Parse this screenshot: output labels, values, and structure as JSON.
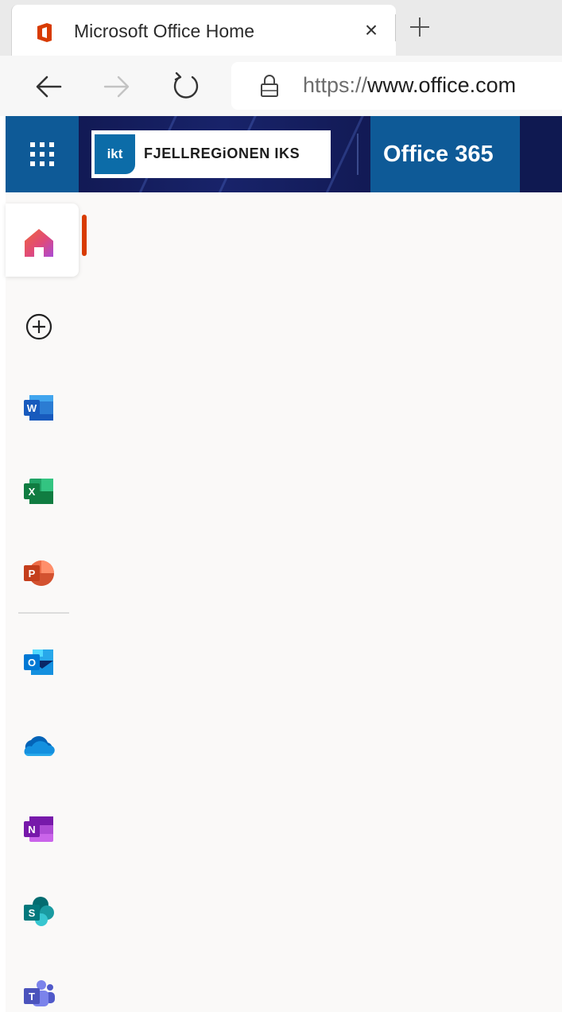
{
  "browser": {
    "tab": {
      "title": "Microsoft Office Home",
      "close_label": "×"
    },
    "address_bar": {
      "url_scheme": "https://",
      "url_host": "www.office.com"
    }
  },
  "header": {
    "org_logo_badge": "ikt",
    "org_logo_text": "FJELLREGiONEN IKS",
    "app_title": "Office 365",
    "colors": {
      "header_bg": "#0f1951",
      "accent_blue": "#0e5a97"
    }
  },
  "rail": {
    "items": [
      {
        "name": "Home",
        "icon": "home-icon",
        "active": true
      },
      {
        "name": "Create",
        "icon": "plus-circle-icon"
      },
      {
        "name": "Word",
        "icon": "word-icon"
      },
      {
        "name": "Excel",
        "icon": "excel-icon"
      },
      {
        "name": "PowerPoint",
        "icon": "powerpoint-icon"
      },
      {
        "name": "Outlook",
        "icon": "outlook-icon"
      },
      {
        "name": "OneDrive",
        "icon": "onedrive-icon"
      },
      {
        "name": "OneNote",
        "icon": "onenote-icon"
      },
      {
        "name": "SharePoint",
        "icon": "sharepoint-icon"
      },
      {
        "name": "Teams",
        "icon": "teams-icon"
      }
    ],
    "icon_letters": {
      "word": "W",
      "excel": "X",
      "powerpoint": "P",
      "outlook": "O",
      "onenote": "N",
      "sharepoint": "S",
      "teams": "T"
    },
    "active_indicator_color": "#d83b01"
  }
}
